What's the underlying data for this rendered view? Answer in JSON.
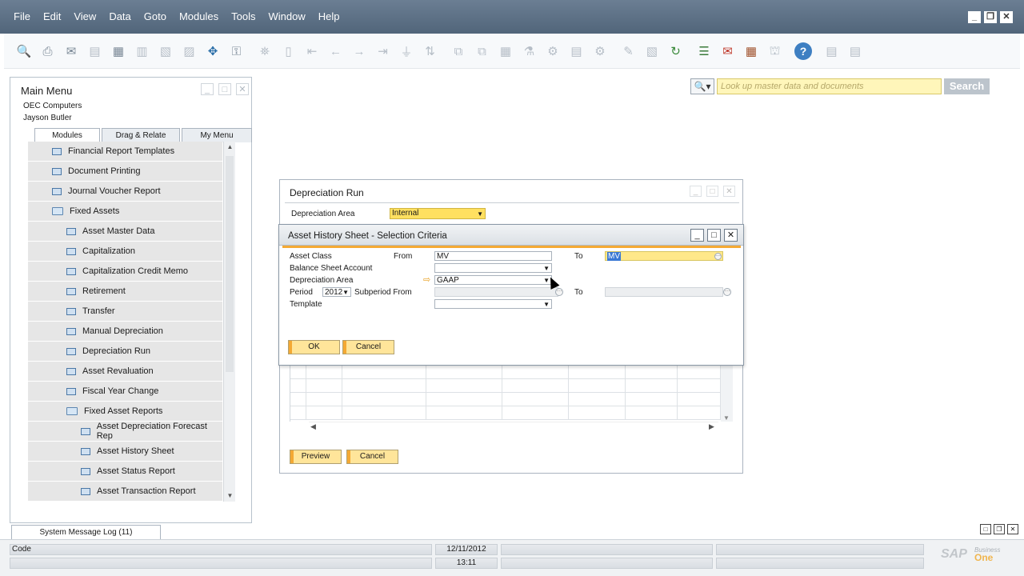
{
  "menubar": {
    "items": [
      "File",
      "Edit",
      "View",
      "Data",
      "Goto",
      "Modules",
      "Tools",
      "Window",
      "Help"
    ],
    "window_controls": [
      "minimize",
      "restore",
      "close"
    ]
  },
  "toolbar": {
    "icons": [
      "print-preview",
      "print",
      "email",
      "export-word",
      "export-excel",
      "export-pdf",
      "save-document",
      "document-generate",
      "browse-arrows",
      "lock",
      "find",
      "add",
      "first-record",
      "previous-record",
      "next-record",
      "last-record",
      "filter",
      "sort",
      "base-document",
      "target-document",
      "report",
      "drill",
      "settings",
      "layout",
      "form-settings",
      "edit",
      "doc-draft",
      "refresh",
      "journal",
      "alert",
      "calendar",
      "structure",
      "help",
      "notes",
      "clipboard"
    ],
    "help_glyph": "?"
  },
  "search": {
    "icon": "search-icon",
    "placeholder": "Look up master data and documents",
    "button": "Search"
  },
  "main_menu": {
    "title": "Main Menu",
    "company": "OEC Computers",
    "user": "Jayson Butler",
    "tabs": [
      "Modules",
      "Drag & Relate",
      "My Menu"
    ],
    "items": [
      {
        "label": "Financial Report Templates",
        "level": 0,
        "type": "form"
      },
      {
        "label": "Document Printing",
        "level": 0,
        "type": "form"
      },
      {
        "label": "Journal Voucher Report",
        "level": 0,
        "type": "form"
      },
      {
        "label": "Fixed Assets",
        "level": 0,
        "type": "folder"
      },
      {
        "label": "Asset Master Data",
        "level": 1,
        "type": "form"
      },
      {
        "label": "Capitalization",
        "level": 1,
        "type": "form"
      },
      {
        "label": "Capitalization Credit Memo",
        "level": 1,
        "type": "form"
      },
      {
        "label": "Retirement",
        "level": 1,
        "type": "form"
      },
      {
        "label": "Transfer",
        "level": 1,
        "type": "form"
      },
      {
        "label": "Manual Depreciation",
        "level": 1,
        "type": "form"
      },
      {
        "label": "Depreciation Run",
        "level": 1,
        "type": "form"
      },
      {
        "label": "Asset Revaluation",
        "level": 1,
        "type": "form"
      },
      {
        "label": "Fiscal Year Change",
        "level": 1,
        "type": "form"
      },
      {
        "label": "Fixed Asset Reports",
        "level": 1,
        "type": "folder"
      },
      {
        "label": "Asset Depreciation Forecast Rep",
        "level": 2,
        "type": "form"
      },
      {
        "label": "Asset History Sheet",
        "level": 2,
        "type": "form"
      },
      {
        "label": "Asset Status Report",
        "level": 2,
        "type": "form"
      },
      {
        "label": "Asset Transaction Report",
        "level": 2,
        "type": "form"
      }
    ]
  },
  "depreciation_run": {
    "title": "Depreciation Run",
    "depreciation_area_label": "Depreciation Area",
    "depreciation_area_value": "Internal",
    "preview_button": "Preview",
    "cancel_button": "Cancel"
  },
  "asset_history": {
    "title": "Asset History Sheet - Selection Criteria",
    "asset_class_label": "Asset Class",
    "from_label": "From",
    "from_value": "MV",
    "to_label": "To",
    "to_value": "MV",
    "balance_sheet_label": "Balance Sheet Account",
    "balance_sheet_value": "",
    "depreciation_area_label": "Depreciation Area",
    "depreciation_area_value": "GAAP",
    "period_label": "Period",
    "period_value": "2012",
    "subperiod_from_label": "Subperiod From",
    "subperiod_to_label": "To",
    "template_label": "Template",
    "template_value": "",
    "ok_button": "OK",
    "cancel_button": "Cancel"
  },
  "status": {
    "message_log_tab": "System Message Log (11)",
    "code_label": "Code",
    "date": "12/11/2012",
    "time": "13:11",
    "logo": {
      "sap": "SAP",
      "business": "Business",
      "one": "One"
    }
  },
  "colors": {
    "menubar": "#5a6e84",
    "accent_orange": "#f4a934",
    "button_yellow": "#ffe59a",
    "field_yellow": "#ffe060",
    "search_field": "#fff6ba",
    "selection": "#3a78d4"
  }
}
